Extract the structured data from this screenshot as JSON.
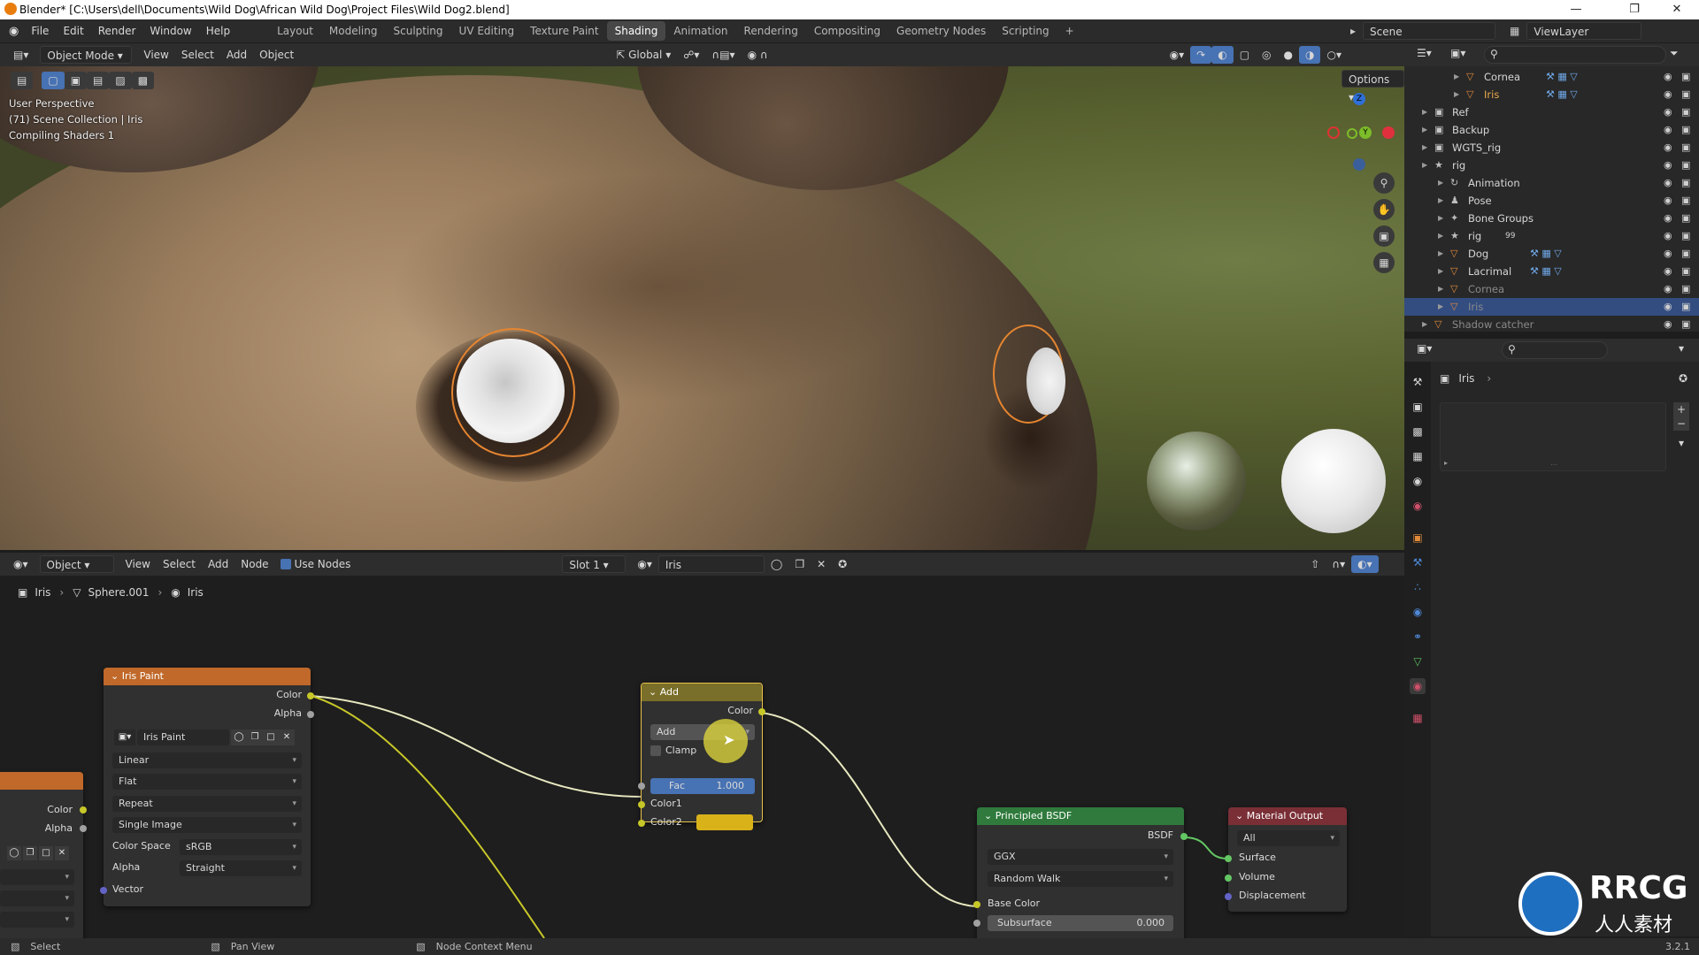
{
  "title": "Blender* [C:\\Users\\dell\\Documents\\Wild Dog\\African Wild Dog\\Project Files\\Wild Dog2.blend]",
  "menu": [
    "File",
    "Edit",
    "Render",
    "Window",
    "Help"
  ],
  "workspaces": [
    "Layout",
    "Modeling",
    "Sculpting",
    "UV Editing",
    "Texture Paint",
    "Shading",
    "Animation",
    "Rendering",
    "Compositing",
    "Geometry Nodes",
    "Scripting",
    "+"
  ],
  "active_workspace": "Shading",
  "scene": {
    "label": "Scene",
    "view_layer": "ViewLayer"
  },
  "viewport_header": {
    "mode": "Object Mode",
    "menus": [
      "View",
      "Select",
      "Add",
      "Object"
    ],
    "transform": "Global",
    "options": "Options"
  },
  "viewport": {
    "info1": "User Perspective",
    "info2": "(71) Scene Collection | Iris",
    "info3": "Compiling Shaders 1",
    "gizmo": {
      "z": "Z",
      "y": "Y"
    }
  },
  "outliner": {
    "rows": [
      {
        "name": "Cornea",
        "indent": 3,
        "type": "mesh"
      },
      {
        "name": "Iris",
        "indent": 3,
        "type": "mesh",
        "active": true
      },
      {
        "name": "Ref",
        "indent": 1,
        "type": "collection"
      },
      {
        "name": "Backup",
        "indent": 1,
        "type": "collection"
      },
      {
        "name": "WGTS_rig",
        "indent": 1,
        "type": "collection"
      },
      {
        "name": "rig",
        "indent": 1,
        "type": "armature"
      },
      {
        "name": "Animation",
        "indent": 2,
        "type": "action"
      },
      {
        "name": "Pose",
        "indent": 2,
        "type": "pose"
      },
      {
        "name": "Bone Groups",
        "indent": 2,
        "type": "group"
      },
      {
        "name": "rig",
        "indent": 2,
        "type": "armature",
        "badge": "99"
      },
      {
        "name": "Dog",
        "indent": 2,
        "type": "mesh"
      },
      {
        "name": "Lacrimal",
        "indent": 2,
        "type": "mesh"
      },
      {
        "name": "Cornea",
        "indent": 2,
        "type": "mesh",
        "dim": true
      },
      {
        "name": "Iris",
        "indent": 2,
        "type": "mesh",
        "selected": true,
        "dim": true
      },
      {
        "name": "Shadow catcher",
        "indent": 1,
        "type": "mesh",
        "dim": true
      }
    ]
  },
  "properties": {
    "object": "Iris"
  },
  "node_header": {
    "type": "Object",
    "menus": [
      "View",
      "Select",
      "Add",
      "Node"
    ],
    "use_nodes": "Use Nodes",
    "slot": "Slot 1",
    "material": "Iris"
  },
  "breadcrumb": [
    "Iris",
    "Sphere.001",
    "Iris"
  ],
  "nodes": {
    "iris_paint": {
      "title": "Iris Paint",
      "out_color": "Color",
      "out_alpha": "Alpha",
      "image": "Iris Paint",
      "interpolation": "Linear",
      "projection": "Flat",
      "extension": "Repeat",
      "source": "Single Image",
      "color_space_label": "Color Space",
      "color_space": "sRGB",
      "alpha_label": "Alpha",
      "alpha": "Straight",
      "vector": "Vector"
    },
    "left_partial": {
      "color": "Color",
      "alpha": "Alpha"
    },
    "add": {
      "title": "Add",
      "out_color": "Color",
      "blend": "Add",
      "clamp": "Clamp",
      "fac_label": "Fac",
      "fac_value": "1.000",
      "fac": 1.0,
      "color1": "Color1",
      "color2": "Color2",
      "color2_hex": "#d9b21a"
    },
    "principled": {
      "title": "Principled BSDF",
      "out": "BSDF",
      "distribution": "GGX",
      "subsurface_method": "Random Walk",
      "base_color": "Base Color",
      "subsurface_label": "Subsurface",
      "subsurface_value": "0.000"
    },
    "output": {
      "title": "Material Output",
      "target": "All",
      "surface": "Surface",
      "volume": "Volume",
      "displacement": "Displacement"
    }
  },
  "status": {
    "select": "Select",
    "pan": "Pan View",
    "ctx": "Node Context Menu",
    "version": "3.2.1"
  },
  "logo": {
    "main": "RRCG",
    "sub": "人人素材"
  },
  "colors": {
    "accent": "#4772b3",
    "node_orange": "#c0692a",
    "node_green": "#2f7a3c",
    "node_red": "#7a2f36",
    "select_blue": "#334d80"
  }
}
